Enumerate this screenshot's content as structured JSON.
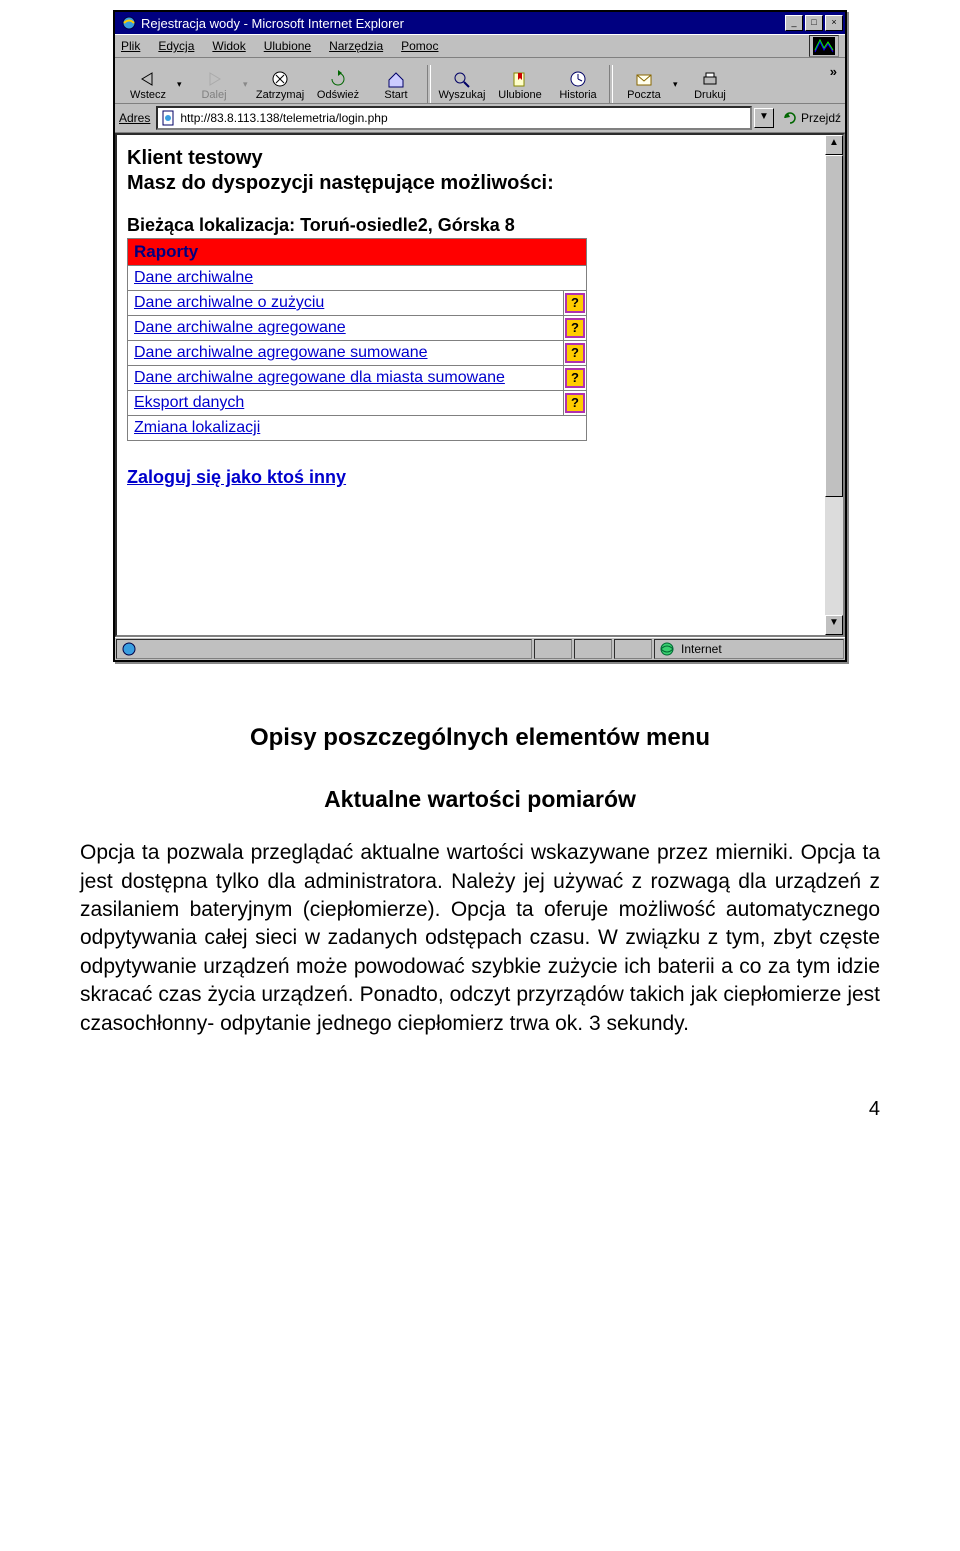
{
  "browser": {
    "title": "Rejestracja wody - Microsoft Internet Explorer",
    "menus": [
      "Plik",
      "Edycja",
      "Widok",
      "Ulubione",
      "Narzędzia",
      "Pomoc"
    ],
    "toolbar": {
      "back": "Wstecz",
      "forward": "Dalej",
      "stop": "Zatrzymaj",
      "refresh": "Odśwież",
      "home": "Start",
      "search": "Wyszukaj",
      "favorites": "Ulubione",
      "history": "Historia",
      "mail": "Poczta",
      "print": "Drukuj"
    },
    "address_label": "Adres",
    "address_url": "http://83.8.113.138/telemetria/login.php",
    "go_label": "Przejdź",
    "status_zone": "Internet"
  },
  "page": {
    "client_title": "Klient testowy",
    "subtitle": "Masz do dyspozycji następujące możliwości:",
    "location": "Bieżąca lokalizacja: Toruń-osiedle2, Górska 8",
    "menu_header": "Raporty",
    "items": [
      {
        "label": "Dane archiwalne",
        "help": false
      },
      {
        "label": "Dane archiwalne o zużyciu",
        "help": true
      },
      {
        "label": "Dane archiwalne agregowane",
        "help": true
      },
      {
        "label": "Dane archiwalne agregowane sumowane",
        "help": true
      },
      {
        "label": "Dane archiwalne agregowane dla miasta sumowane",
        "help": true
      },
      {
        "label": "Eksport danych",
        "help": true
      },
      {
        "label": "Zmiana lokalizacji",
        "help": false
      }
    ],
    "login_other": "Zaloguj się jako ktoś inny",
    "help_char": "?"
  },
  "doc": {
    "heading1": "Opisy poszczególnych elementów menu",
    "heading2": "Aktualne wartości pomiarów",
    "body": "Opcja ta pozwala przeglądać aktualne wartości wskazywane przez mierniki. Opcja ta jest dostępna tylko dla administratora. Należy jej używać z rozwagą dla urządzeń z zasilaniem bateryjnym (ciepłomierze). Opcja ta oferuje możliwość automatycznego odpytywania całej sieci w zadanych odstępach czasu. W związku z tym, zbyt częste odpytywanie urządzeń może powodować szybkie zużycie ich baterii a co za tym idzie skracać czas życia urządzeń. Ponadto, odczyt przyrządów takich jak ciepłomierze jest czasochłonny- odpytanie jednego ciepłomierz trwa ok. 3 sekundy.",
    "page_number": "4"
  }
}
